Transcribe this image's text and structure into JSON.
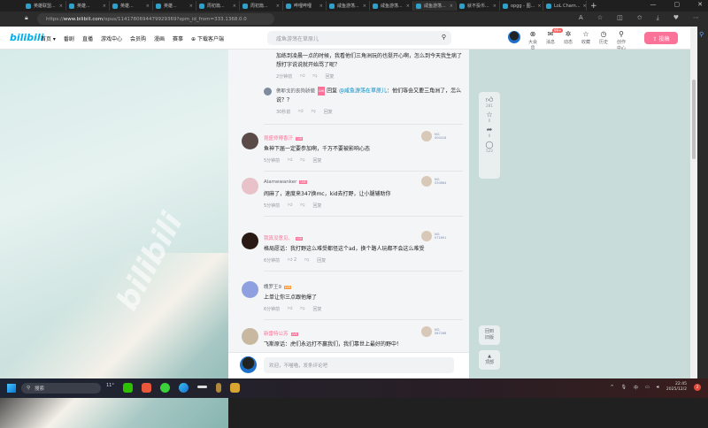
{
  "browser": {
    "tabs": [
      {
        "label": "英雄联盟..."
      },
      {
        "label": "英雄..."
      },
      {
        "label": "英雄..."
      },
      {
        "label": "英雄..."
      },
      {
        "label": "周初篇..."
      },
      {
        "label": "周初篇..."
      },
      {
        "label": "哔哩哔哩"
      },
      {
        "label": "咸鱼游荡..."
      },
      {
        "label": "咸鱼游荡..."
      },
      {
        "label": "咸鱼游荡..."
      },
      {
        "label": "就不投币..."
      },
      {
        "label": "opgg - 图..."
      },
      {
        "label": "LoL Cham..."
      }
    ],
    "url_prefix": "https://",
    "url_domain": "www.bilibili.com",
    "url_path": "/opus/1141780694479929369?spm_id_from=333.1368.0.0"
  },
  "header": {
    "logo": "bilibili",
    "nav": [
      "首页 ▾",
      "番剧",
      "直播",
      "游戏中心",
      "会员购",
      "漫画",
      "赛事",
      "⊕ 下载客户端"
    ],
    "search_placeholder": "咸鱼游荡在草原儿",
    "icons": [
      {
        "label": "大会员",
        "icon": "vip-icon",
        "glyph": "⊗"
      },
      {
        "label": "消息",
        "icon": "message-icon",
        "glyph": "✉",
        "badge": "99+"
      },
      {
        "label": "动态",
        "icon": "dynamic-icon",
        "glyph": "✲"
      },
      {
        "label": "收藏",
        "icon": "favorite-icon",
        "glyph": "☆"
      },
      {
        "label": "历史",
        "icon": "history-icon",
        "glyph": "◷"
      },
      {
        "label": "创作中心",
        "icon": "creator-icon",
        "glyph": "⚲"
      }
    ],
    "upload_label": "⇪ 投稿"
  },
  "comments": {
    "top_continuation": {
      "text": "加练到凌晨一点的时候，我看他们三角洲玩的也挺开心啊，怎么到今天我生病了想打字说说就开始骂了呢？",
      "time": "2分钟前",
      "reply": "回复"
    },
    "sub_reply": {
      "user": "佛耶戈的丧狗骄傲",
      "level": "LV6",
      "prefix": "回复 ",
      "mention": "@咸鱼游荡在草原儿",
      "text": "：他们等会又要三角洲了，怎么说？？",
      "time": "30秒前",
      "reply": "回复"
    },
    "items": [
      {
        "user": "昆盛师傅香汗",
        "level": "LV6",
        "text": "鱼神下届一定要参加啊，千万不要被影响心态",
        "time": "5分钟前",
        "likes": "",
        "reply": "回复",
        "fan": "NO.\n000418"
      },
      {
        "user": "Alamewanker",
        "level": "LV6",
        "text": "闹麻了，速度来347换mc，kid去打野，让小腿辅助你",
        "time": "5分钟前",
        "likes": "",
        "reply": "回复",
        "fan": "NO.\n050864"
      },
      {
        "user": "我真没意见、",
        "level": "LV6",
        "text": "格局愿话：我打野这么难受都怪这个ad，换个路人玩都不会这么难受",
        "time": "6分钟前",
        "likes": "2",
        "reply": "回复",
        "fan": "NO.\n071691"
      },
      {
        "user": "魄罗王9",
        "level": "LV5",
        "text": "上单让你三点跟他爆了",
        "time": "6分钟前",
        "likes": "",
        "reply": "回复",
        "fan": ""
      },
      {
        "user": "新雷特公苏",
        "level": "LV6",
        "text": "飞斯原话：虎们永远打不赢我们，我们靠世上最好的野中！",
        "time": "",
        "likes": "",
        "reply": "",
        "fan": "NO.\n087288"
      }
    ],
    "input_placeholder": "欢迎，不喵喵，发条评论吧"
  },
  "rail": {
    "like_count": "281",
    "favorite_count": "0",
    "share_count": "0",
    "comment_count": "523",
    "old_version": "回到旧版",
    "top": "顶部"
  },
  "taskbar": {
    "search": "搜索",
    "weather": "11°",
    "ime": "中",
    "time": "22:45",
    "date": "2025/12/2",
    "notifications": "2"
  },
  "watermark": "bilibili"
}
